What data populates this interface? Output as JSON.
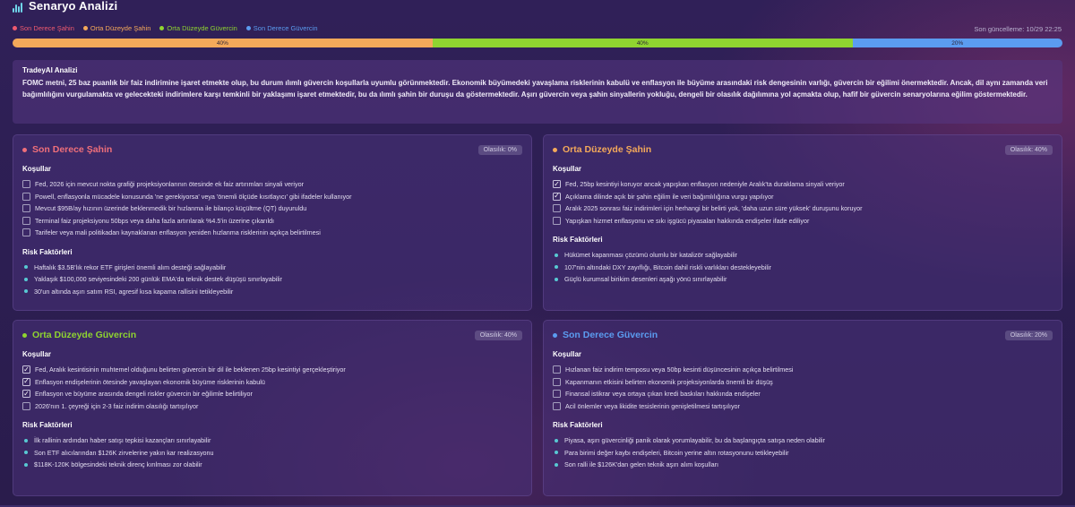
{
  "header": {
    "title": "Senaryo Analizi",
    "icon": "bar-chart-icon"
  },
  "legend": [
    {
      "label": "Son Derece Şahin",
      "color": "#ef5a6f"
    },
    {
      "label": "Orta Düzeyde Şahin",
      "color": "#f4a95a"
    },
    {
      "label": "Orta Düzeyde Güvercin",
      "color": "#8fd430"
    },
    {
      "label": "Son Derece Güvercin",
      "color": "#5b9cf0"
    }
  ],
  "updated": "Son güncelleme: 10/29 22:25",
  "distribution": [
    {
      "label": "40%",
      "value": 40,
      "color": "#f4a95a"
    },
    {
      "label": "40%",
      "value": 40,
      "color": "#8fd430"
    },
    {
      "label": "20%",
      "value": 20,
      "color": "#5b9cf0"
    }
  ],
  "analysis": {
    "title": "TradeyAI Analizi",
    "body": "FOMC metni, 25 baz puanlık bir faiz indirimine işaret etmekte olup, bu durum ılımlı güvercin koşullarla uyumlu görünmektedir. Ekonomik büyümedeki yavaşlama risklerinin kabulü ve enflasyon ile büyüme arasındaki risk dengesinin varlığı, güvercin bir eğilimi önermektedir. Ancak, dil aynı zamanda veri bağımlılığını vurgulamakta ve gelecekteki indirimlere karşı temkinli bir yaklaşımı işaret etmektedir, bu da ılımlı şahin bir duruşu da göstermektedir. Aşırı güvercin veya şahin sinyallerin yokluğu, dengeli bir olasılık dağılımına yol açmakta olup, hafif bir güvercin senaryolarına eğilim göstermektedir."
  },
  "cards": [
    {
      "name": "Son Derece Şahin",
      "color": "#ef6f7a",
      "probability": "Olasılık: 0%",
      "conditions_title": "Koşullar",
      "conditions": [
        {
          "text": "Fed, 2026 için mevcut nokta grafiği projeksiyonlarının ötesinde ek faiz artırımları sinyali veriyor",
          "checked": false
        },
        {
          "text": "Powell, enflasyonla mücadele konusunda 'ne gerekiyorsa' veya 'önemli ölçüde kısıtlayıcı' gibi ifadeler kullanıyor",
          "checked": false
        },
        {
          "text": "Mevcut $95B/ay hızının üzerinde beklenmedik bir hızlanma ile bilanço küçültme (QT) duyuruldu",
          "checked": false
        },
        {
          "text": "Terminal faiz projeksiyonu 50bps veya daha fazla artırılarak %4.5'in üzerine çıkarıldı",
          "checked": false
        },
        {
          "text": "Tarifeler veya mali politikadan kaynaklanan enflasyon yeniden hızlanma risklerinin açıkça belirtilmesi",
          "checked": false
        }
      ],
      "risks_title": "Risk Faktörleri",
      "risks": [
        "Haftalık $3.5B'lık rekor ETF girişleri önemli alım desteği sağlayabilir",
        "Yaklaşık $100,000 seviyesindeki 200 günlük EMA'da teknik destek düşüşü sınırlayabilir",
        "30'un altında aşırı satım RSI, agresif kısa kapama rallisini tetikleyebilir"
      ]
    },
    {
      "name": "Orta Düzeyde Şahin",
      "color": "#f4a95a",
      "probability": "Olasılık: 40%",
      "conditions_title": "Koşullar",
      "conditions": [
        {
          "text": "Fed, 25bp kesintiyi koruyor ancak yapışkan enflasyon nedeniyle Aralık'ta duraklama sinyali veriyor",
          "checked": true
        },
        {
          "text": "Açıklama dilinde açık bir şahin eğilim ile veri bağımlılığına vurgu yapılıyor",
          "checked": true
        },
        {
          "text": "Aralık 2025 sonrası faiz indirimleri için herhangi bir belirti yok, 'daha uzun süre yüksek' duruşunu koruyor",
          "checked": false
        },
        {
          "text": "Yapışkan hizmet enflasyonu ve sıkı işgücü piyasaları hakkında endişeler ifade ediliyor",
          "checked": false
        }
      ],
      "risks_title": "Risk Faktörleri",
      "risks": [
        "Hükümet kapanması çözümü olumlu bir katalizör sağlayabilir",
        "107'nin altındaki DXY zayıflığı, Bitcoin dahil riskli varlıkları destekleyebilir",
        "Güçlü kurumsal birikim desenleri aşağı yönü sınırlayabilir"
      ]
    },
    {
      "name": "Orta Düzeyde Güvercin",
      "color": "#8fd430",
      "probability": "Olasılık: 40%",
      "conditions_title": "Koşullar",
      "conditions": [
        {
          "text": "Fed, Aralık kesintisinin muhtemel olduğunu belirten güvercin bir dil ile beklenen 25bp kesintiyi gerçekleştiriyor",
          "checked": true
        },
        {
          "text": "Enflasyon endişelerinin ötesinde yavaşlayan ekonomik büyüme risklerinin kabulü",
          "checked": true
        },
        {
          "text": "Enflasyon ve büyüme arasında dengeli riskler güvercin bir eğilimle belirtiliyor",
          "checked": true
        },
        {
          "text": "2026'nın 1. çeyreği için 2-3 faiz indirim olasılığı tartışılıyor",
          "checked": false
        }
      ],
      "risks_title": "Risk Faktörleri",
      "risks": [
        "İlk rallinin ardından haber satışı tepkisi kazançları sınırlayabilir",
        "Son ETF alıcılarından $126K zirvelerine yakın kar realizasyonu",
        "$118K-120K bölgesindeki teknik direnç kırılması zor olabilir"
      ]
    },
    {
      "name": "Son Derece Güvercin",
      "color": "#5b9cf0",
      "probability": "Olasılık: 20%",
      "conditions_title": "Koşullar",
      "conditions": [
        {
          "text": "Hızlanan faiz indirim temposu veya 50bp kesinti düşüncesinin açıkça belirtilmesi",
          "checked": false
        },
        {
          "text": "Kapanmanın etkisini belirten ekonomik projeksiyonlarda önemli bir düşüş",
          "checked": false
        },
        {
          "text": "Finansal istikrar veya ortaya çıkan kredi baskıları hakkında endişeler",
          "checked": false
        },
        {
          "text": "Acil önlemler veya likidite tesislerinin genişletilmesi tartışılıyor",
          "checked": false
        }
      ],
      "risks_title": "Risk Faktörleri",
      "risks": [
        "Piyasa, aşırı güvercinliği panik olarak yorumlayabilir, bu da başlangıçta satışa neden olabilir",
        "Para birimi değer kaybı endişeleri, Bitcoin yerine altın rotasyonunu tetikleyebilir",
        "Son ralli ile $126K'dan gelen teknik aşırı alım koşulları"
      ]
    }
  ]
}
